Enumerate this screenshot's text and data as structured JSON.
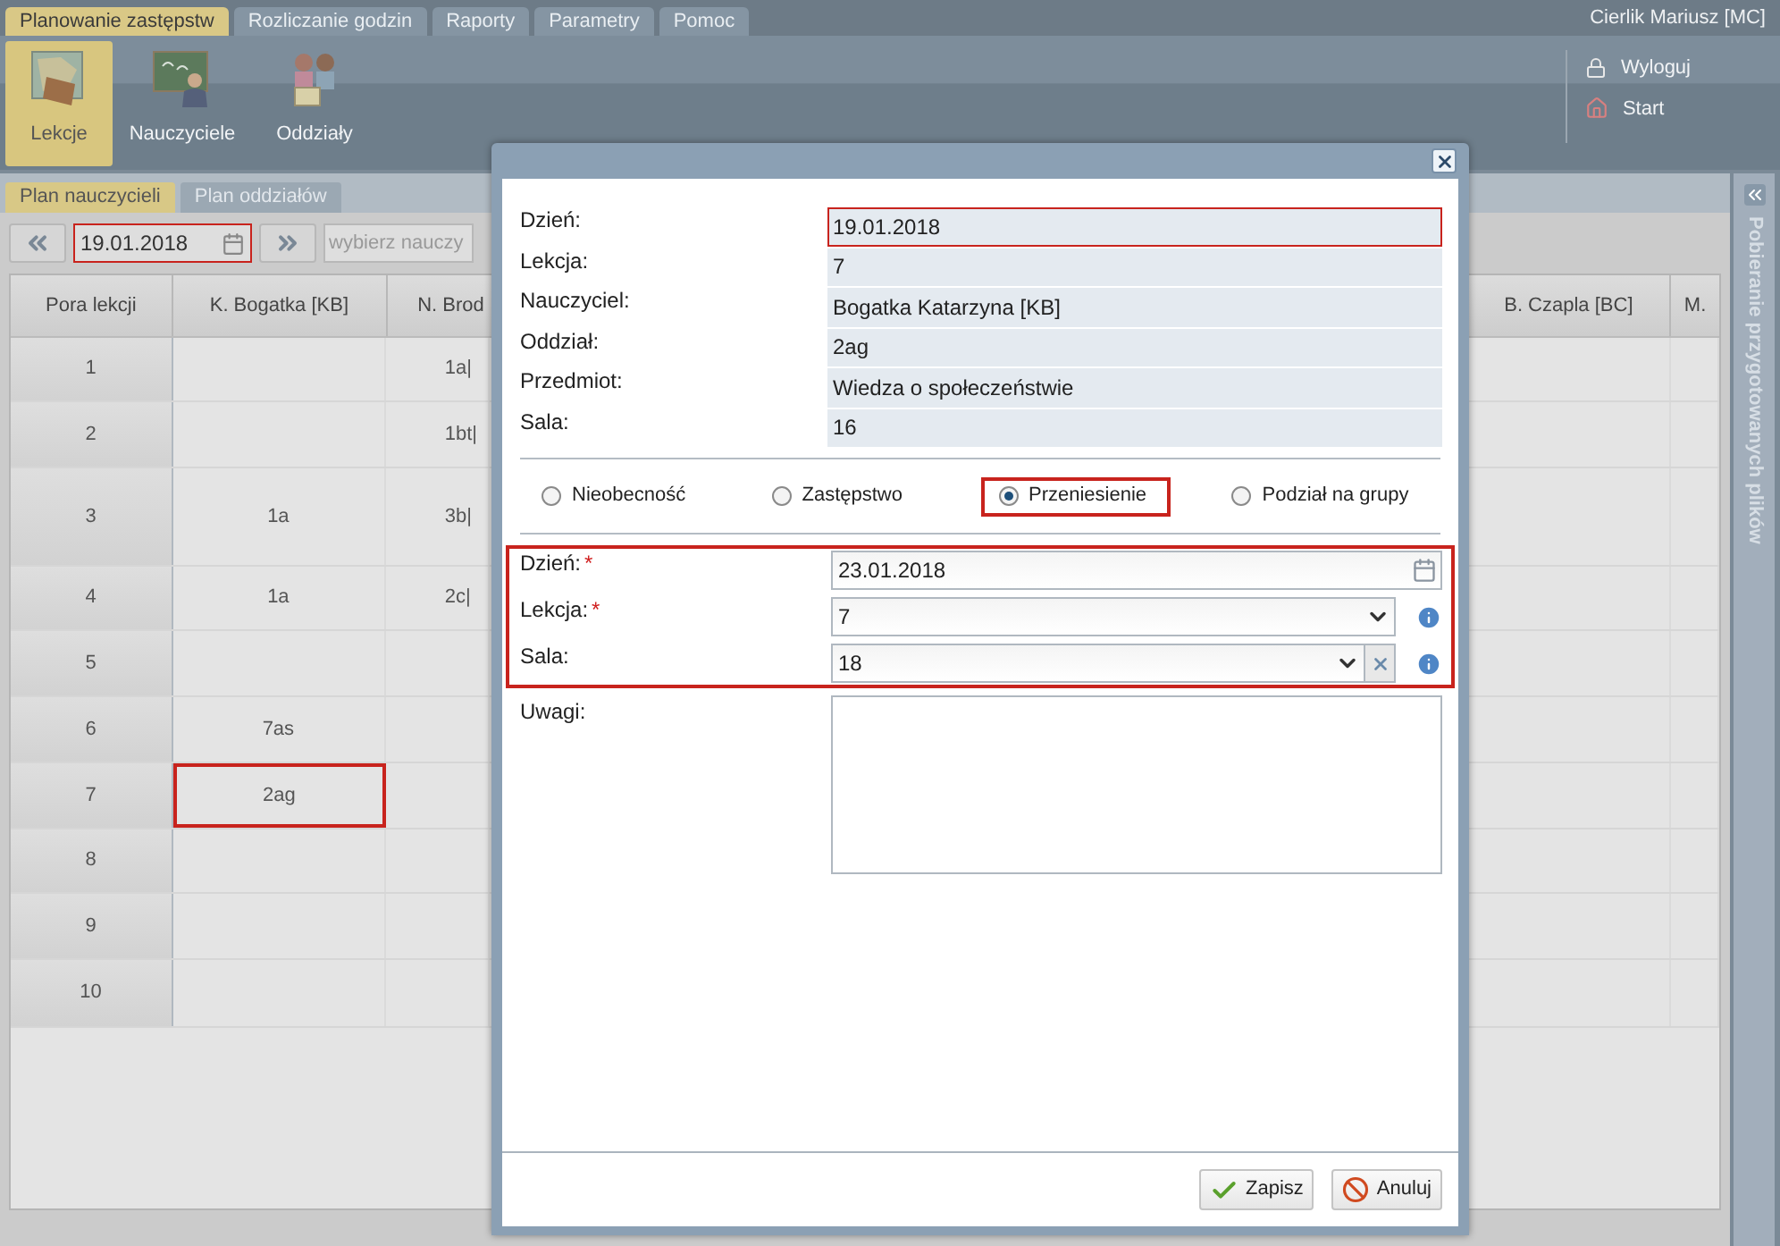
{
  "top_tabs": [
    {
      "label": "Planowanie zastępstw",
      "selected": true
    },
    {
      "label": "Rozliczanie godzin",
      "selected": false
    },
    {
      "label": "Raporty",
      "selected": false
    },
    {
      "label": "Parametry",
      "selected": false
    },
    {
      "label": "Pomoc",
      "selected": false
    }
  ],
  "user": "Cierlik Mariusz [MC]",
  "ribbon": [
    {
      "label": "Lekcje",
      "kind": "lessons",
      "selected": true
    },
    {
      "label": "Nauczyciele",
      "kind": "teachers",
      "selected": false
    },
    {
      "label": "Oddziały",
      "kind": "classes",
      "selected": false
    }
  ],
  "account_links": [
    {
      "label": "Wyloguj",
      "kind": "lock"
    },
    {
      "label": "Start",
      "kind": "home"
    }
  ],
  "sub_tabs": [
    {
      "label": "Plan nauczycieli",
      "selected": true
    },
    {
      "label": "Plan oddziałów",
      "selected": false
    }
  ],
  "toolbar": {
    "date": "19.01.2018",
    "date_highlighted": true,
    "search_placeholder": "wybierz nauczy"
  },
  "table": {
    "columns": [
      "Pora lekcji",
      "K. Bogatka [KB]",
      "N. Brod",
      "B. Czapla [BC]",
      "M."
    ],
    "rows": [
      {
        "cells": [
          {
            "kind": "period",
            "text": "1"
          },
          {
            "kind": "lesson",
            "highlighted": false
          },
          {
            "kind": "lesson",
            "text": "1a|",
            "highlighted": false
          },
          {
            "kind": "lesson",
            "highlighted": false
          },
          {
            "kind": "lesson",
            "highlighted": false
          }
        ]
      },
      {
        "cells": [
          {
            "kind": "period",
            "text": "2"
          },
          {
            "kind": "lesson",
            "highlighted": false
          },
          {
            "kind": "lesson",
            "text": "1bt|",
            "highlighted": false
          },
          {
            "kind": "lesson",
            "highlighted": false
          },
          {
            "kind": "lesson",
            "highlighted": false
          }
        ]
      },
      {
        "cells": [
          {
            "kind": "period",
            "text": "3"
          },
          {
            "kind": "lesson",
            "text": "1a",
            "highlighted": false
          },
          {
            "kind": "lesson",
            "text": "3b|",
            "highlighted": false
          },
          {
            "kind": "lesson",
            "highlighted": false
          },
          {
            "kind": "lesson",
            "highlighted": false
          }
        ]
      },
      {
        "cells": [
          {
            "kind": "period",
            "text": "4"
          },
          {
            "kind": "lesson",
            "text": "1a",
            "highlighted": false
          },
          {
            "kind": "lesson",
            "text": "2c|",
            "highlighted": false
          },
          {
            "kind": "lesson",
            "highlighted": false
          },
          {
            "kind": "lesson",
            "highlighted": false
          }
        ]
      },
      {
        "cells": [
          {
            "kind": "period",
            "text": "5"
          },
          {
            "kind": "lesson",
            "highlighted": false
          },
          {
            "kind": "lesson",
            "highlighted": false
          },
          {
            "kind": "lesson",
            "highlighted": false
          },
          {
            "kind": "lesson",
            "highlighted": false
          }
        ]
      },
      {
        "cells": [
          {
            "kind": "period",
            "text": "6"
          },
          {
            "kind": "lesson",
            "text": "7as",
            "highlighted": false
          },
          {
            "kind": "lesson",
            "highlighted": false
          },
          {
            "kind": "lesson",
            "highlighted": false
          },
          {
            "kind": "lesson",
            "highlighted": false
          }
        ]
      },
      {
        "cells": [
          {
            "kind": "period",
            "text": "7"
          },
          {
            "kind": "lesson",
            "text": "2ag",
            "highlighted": true
          },
          {
            "kind": "lesson",
            "highlighted": false
          },
          {
            "kind": "lesson",
            "highlighted": false
          },
          {
            "kind": "lesson",
            "highlighted": false
          }
        ]
      },
      {
        "cells": [
          {
            "kind": "period",
            "text": "8"
          },
          {
            "kind": "lesson",
            "highlighted": false
          },
          {
            "kind": "lesson",
            "highlighted": false
          },
          {
            "kind": "lesson",
            "highlighted": false
          },
          {
            "kind": "lesson",
            "highlighted": false
          }
        ]
      },
      {
        "cells": [
          {
            "kind": "period",
            "text": "9"
          },
          {
            "kind": "lesson",
            "highlighted": false
          },
          {
            "kind": "lesson",
            "highlighted": false
          },
          {
            "kind": "lesson",
            "highlighted": false
          },
          {
            "kind": "lesson",
            "highlighted": false
          }
        ]
      },
      {
        "cells": [
          {
            "kind": "period",
            "text": "10"
          },
          {
            "kind": "lesson",
            "highlighted": false
          },
          {
            "kind": "lesson",
            "highlighted": false
          },
          {
            "kind": "lesson",
            "highlighted": false
          },
          {
            "kind": "lesson",
            "highlighted": false
          }
        ]
      }
    ]
  },
  "side_panel": {
    "title": "Pobieranie przygotowanych plików"
  },
  "dialog": {
    "info": [
      {
        "label": "Dzień:",
        "value": "19.01.2018",
        "highlighted": true
      },
      {
        "label": "Lekcja:",
        "value": "7",
        "highlighted": false
      },
      {
        "label": "Nauczyciel:",
        "value": "Bogatka Katarzyna [KB]",
        "highlighted": false
      },
      {
        "label": "Oddział:",
        "value": "2ag",
        "highlighted": false
      },
      {
        "label": "Przedmiot:",
        "value": "Wiedza o społeczeństwie",
        "highlighted": false
      },
      {
        "label": "Sala:",
        "value": "16",
        "highlighted": false
      }
    ],
    "options": [
      {
        "label": "Nieobecność",
        "selected": false
      },
      {
        "label": "Zastępstwo",
        "selected": false
      },
      {
        "label": "Przeniesienie",
        "selected": true
      },
      {
        "label": "Podział na grupy",
        "selected": false
      }
    ],
    "fields_highlighted": true,
    "fields": [
      {
        "kind": "date",
        "label": "Dzień:",
        "required": true,
        "value": "23.01.2018"
      },
      {
        "kind": "select",
        "label": "Lekcja:",
        "required": true,
        "value": "7"
      },
      {
        "kind": "select_clear",
        "label": "Sala:",
        "required": false,
        "value": "18"
      }
    ],
    "required_mark": "*",
    "notes": {
      "label": "Uwagi:"
    },
    "buttons": [
      {
        "label": "Zapisz",
        "kind": "save"
      },
      {
        "label": "Anuluj",
        "kind": "cancel"
      }
    ]
  }
}
